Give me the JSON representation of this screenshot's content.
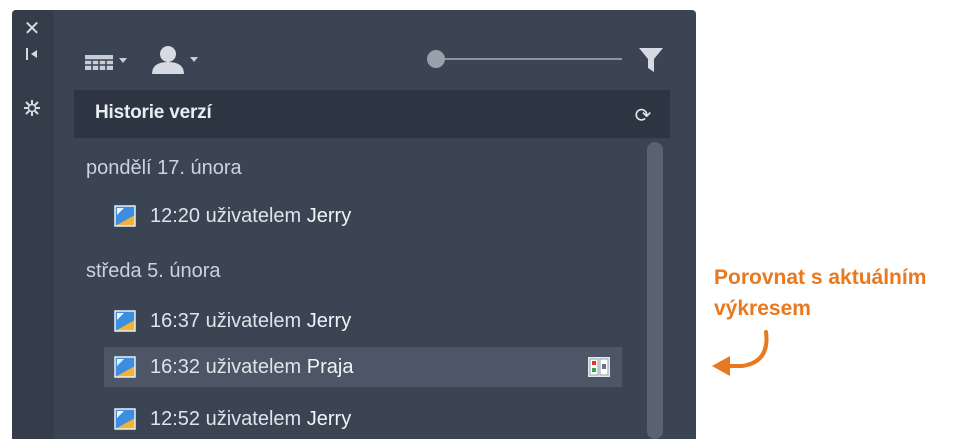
{
  "side_strip": {
    "close_icon": "close-icon",
    "collapse_icon": "collapse-icon",
    "settings_icon": "settings-icon"
  },
  "toolbar": {
    "view_icon": "grid-view-icon",
    "user_icon": "user-icon",
    "slider_level": 0.0,
    "filter_icon": "filter-icon"
  },
  "panel": {
    "title": "Historie verzí",
    "refresh_icon": "refresh-icon"
  },
  "groups": [
    {
      "date": "pondělí 17. února",
      "entries": [
        {
          "time_by": "12:20 uživatelem",
          "user": "Jerry",
          "selected": false
        }
      ]
    },
    {
      "date": "středa 5. února",
      "entries": [
        {
          "time_by": "16:37 uživatelem",
          "user": "Jerry",
          "selected": false
        },
        {
          "time_by": "16:32 uživatelem",
          "user": "Praja",
          "selected": true
        },
        {
          "time_by": "12:52 uživatelem",
          "user": "Jerry",
          "selected": false
        }
      ]
    }
  ],
  "callout": {
    "line1": "Porovnat s aktuálním",
    "line2": "výkresem",
    "color": "#e8791e"
  },
  "colors": {
    "palette_bg": "#3b4453",
    "header_bg": "#2e3542",
    "selected_row": "#4d5666",
    "accent": "#e8791e"
  }
}
